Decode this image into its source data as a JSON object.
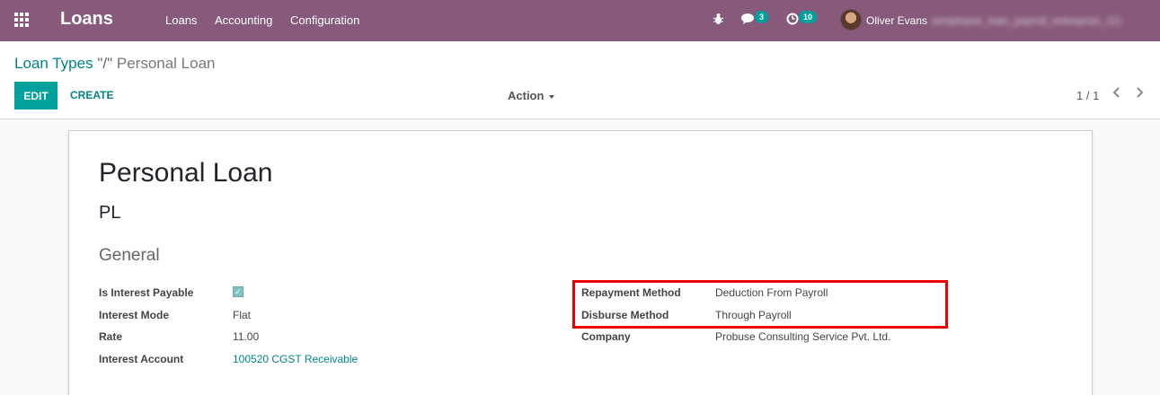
{
  "navbar": {
    "app_name": "Loans",
    "menu": [
      "Loans",
      "Accounting",
      "Configuration"
    ],
    "messages_count": "3",
    "activities_count": "10",
    "user_name": "Oliver Evans",
    "db_name": "(employee_loan_payroll_enterprise_11)",
    "bg_color": "#875a7b"
  },
  "breadcrumb": {
    "parent": "Loan Types",
    "separator": "\"/\"",
    "current": "Personal Loan"
  },
  "toolbar": {
    "edit_label": "EDIT",
    "create_label": "CREATE",
    "action_label": "Action",
    "pager": "1 / 1"
  },
  "form": {
    "name": "Personal Loan",
    "code": "PL",
    "section_title": "General",
    "left_fields": [
      {
        "label": "Is Interest Payable",
        "value": ""
      },
      {
        "label": "Interest Mode",
        "value": "Flat"
      },
      {
        "label": "Rate",
        "value": "11.00"
      },
      {
        "label": "Interest Account",
        "value": "100520 CGST Receivable"
      }
    ],
    "right_fields": [
      {
        "label": "Repayment Method",
        "value": "Deduction From Payroll"
      },
      {
        "label": "Disburse Method",
        "value": "Through Payroll"
      },
      {
        "label": "Company",
        "value": "Probuse Consulting Service Pvt. Ltd."
      }
    ]
  },
  "accent_color": "#00a09d",
  "highlight_color": "#ee0000"
}
